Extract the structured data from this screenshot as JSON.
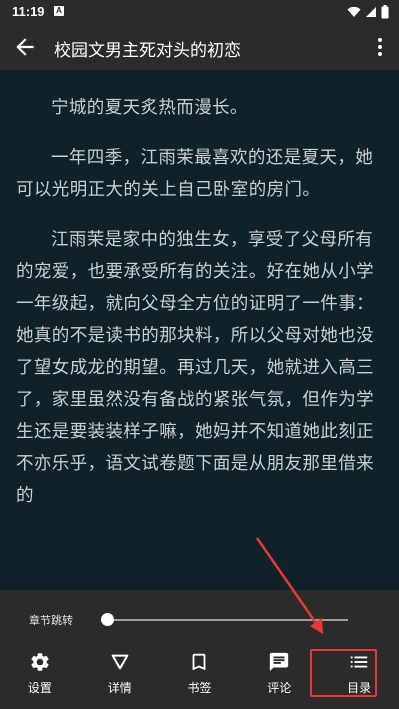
{
  "status_bar": {
    "time": "11:19",
    "notification_badge": "A"
  },
  "app_bar": {
    "title": "校园文男主死对头的初恋",
    "back_icon": "arrow-left-icon",
    "more_icon": "more-vert-icon"
  },
  "content": {
    "paragraphs": [
      "宁城的夏天炙热而漫长。",
      "一年四季，江雨茉最喜欢的还是夏天，她可以光明正大的关上自己卧室的房门。",
      "江雨茉是家中的独生女，享受了父母所有的宠爱，也要承受所有的关注。好在她从小学一年级起，就向父母全方位的证明了一件事：她真的不是读书的那块料，所以父母对她也没了望女成龙的期望。再过几天，她就进入高三了，家里虽然没有备战的紧张气氛，但作为学生还是要装装样子嘛，她妈并不知道她此刻正不亦乐乎，语文试卷题下面是从朋友那里借来的"
    ]
  },
  "bottom_panel": {
    "chapter_jump_label": "章节跳转",
    "chapter_progress": 0.0,
    "nav": [
      {
        "label": "设置",
        "icon": "gear-icon"
      },
      {
        "label": "详情",
        "icon": "triangle-down-icon"
      },
      {
        "label": "书签",
        "icon": "bookmark-icon"
      },
      {
        "label": "评论",
        "icon": "comment-icon"
      },
      {
        "label": "目录",
        "icon": "list-icon"
      }
    ]
  },
  "colors": {
    "content_bg": "#0f2129",
    "bar_bg": "#2b2b2b",
    "text": "#c9d0d3",
    "highlight": "#e53935"
  }
}
